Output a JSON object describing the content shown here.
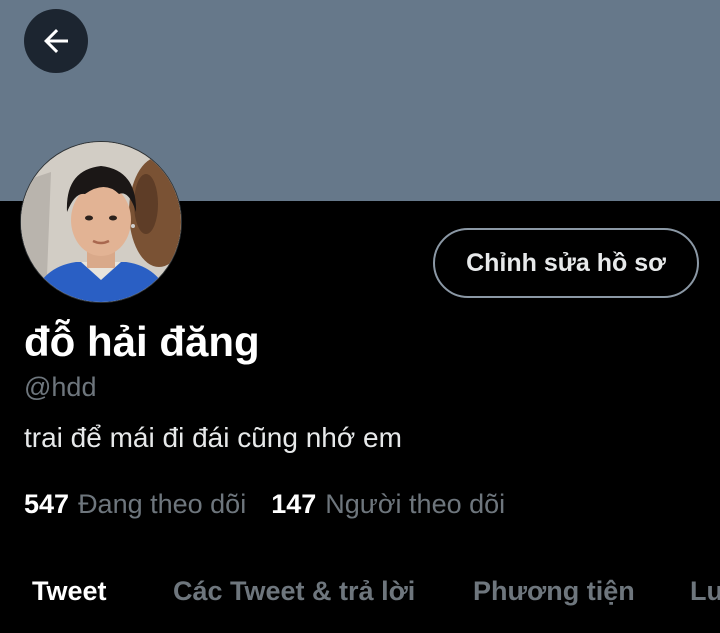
{
  "header": {
    "back_icon": "arrow-left-icon",
    "banner_color": "#66788a"
  },
  "profile": {
    "avatar_icon": "profile-photo",
    "edit_button_label": "Chỉnh sửa hồ sơ",
    "display_name": "đỗ hải đăng",
    "handle": "@hdd",
    "bio": "trai để mái đi đái cũng nhớ em",
    "following_count": "547",
    "following_label": "Đang theo dõi",
    "followers_count": "147",
    "followers_label": "Người theo dõi"
  },
  "tabs": [
    {
      "label": "Tweet",
      "active": true
    },
    {
      "label": "Các Tweet & trả lời",
      "active": false
    },
    {
      "label": "Phương tiện",
      "active": false
    },
    {
      "label": "Lượt thích",
      "active": false
    }
  ],
  "colors": {
    "background": "#000000",
    "text_primary": "#ffffff",
    "text_secondary": "#6e767d",
    "button_border": "#8b98a5"
  }
}
